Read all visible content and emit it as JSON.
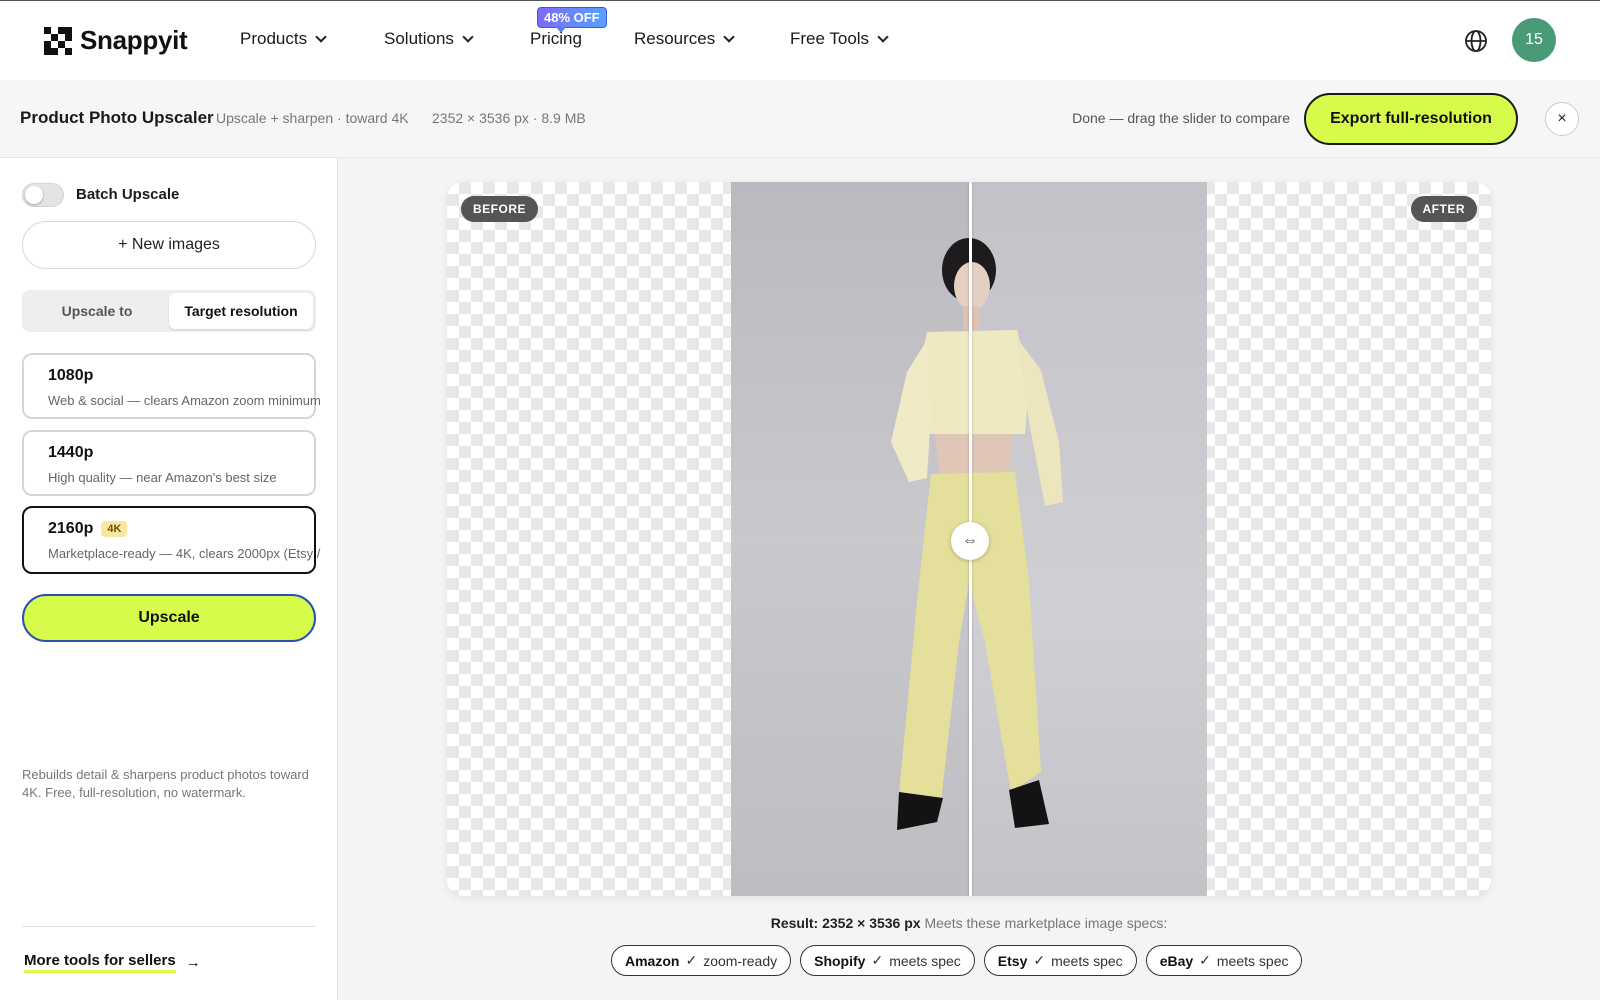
{
  "nav": {
    "logo_text": "Snappyit",
    "items": [
      {
        "label": "Products"
      },
      {
        "label": "Solutions"
      },
      {
        "label": "Pricing"
      },
      {
        "label": "Resources"
      },
      {
        "label": "Free Tools"
      }
    ],
    "promo_badge": "48% OFF",
    "avatar_text": "15"
  },
  "toolbar": {
    "title": "Product Photo Upscaler",
    "subtitle": "Upscale + sharpen · toward 4K",
    "file_meta": "2352 × 3536 px · 8.9 MB",
    "status": "Done — drag the slider to compare",
    "export_label": "Export full-resolution",
    "close_glyph": "×"
  },
  "sidebar": {
    "batch_label": "Batch Upscale",
    "batch_enabled": false,
    "new_images_label": "+ New images",
    "segments": [
      {
        "label": "Upscale to",
        "active": false
      },
      {
        "label": "Target resolution",
        "active": true
      }
    ],
    "resolutions": [
      {
        "name": "1080p",
        "desc": "Web & social — clears Amazon zoom minimum",
        "badge": ""
      },
      {
        "name": "1440p",
        "desc": "High quality — near Amazon's best size",
        "badge": ""
      },
      {
        "name": "2160p",
        "desc": "Marketplace-ready — 4K, clears 2000px (Etsy /",
        "badge": "4K",
        "selected": true
      }
    ],
    "upscale_label": "Upscale",
    "note": "Rebuilds detail & sharpens product photos toward 4K. Free, full-resolution, no watermark.",
    "more_tools_label": "More tools for sellers",
    "more_tools_arrow": "→"
  },
  "canvas": {
    "before_label": "BEFORE",
    "after_label": "AFTER",
    "handle_glyph": "⇔"
  },
  "result": {
    "prefix": "Result: 2352 × 3536 px",
    "suffix": "Meets these marketplace image specs:",
    "chips": [
      {
        "name": "Amazon",
        "check": "✓",
        "status": "zoom-ready"
      },
      {
        "name": "Shopify",
        "check": "✓",
        "status": "meets spec"
      },
      {
        "name": "Etsy",
        "check": "✓",
        "status": "meets spec"
      },
      {
        "name": "eBay",
        "check": "✓",
        "status": "meets spec"
      }
    ]
  },
  "colors": {
    "accent_lime": "#d6fb4a",
    "avatar_green": "#4a9a77",
    "upscale_border": "#2b4fb6",
    "badge_4k": "#f8e7a0"
  },
  "icons": {
    "logo": "snappyit-logo-icon",
    "globe": "globe-icon",
    "close": "close-icon",
    "compare": "compare-handle-icon",
    "arrow": "arrow-right-icon"
  }
}
